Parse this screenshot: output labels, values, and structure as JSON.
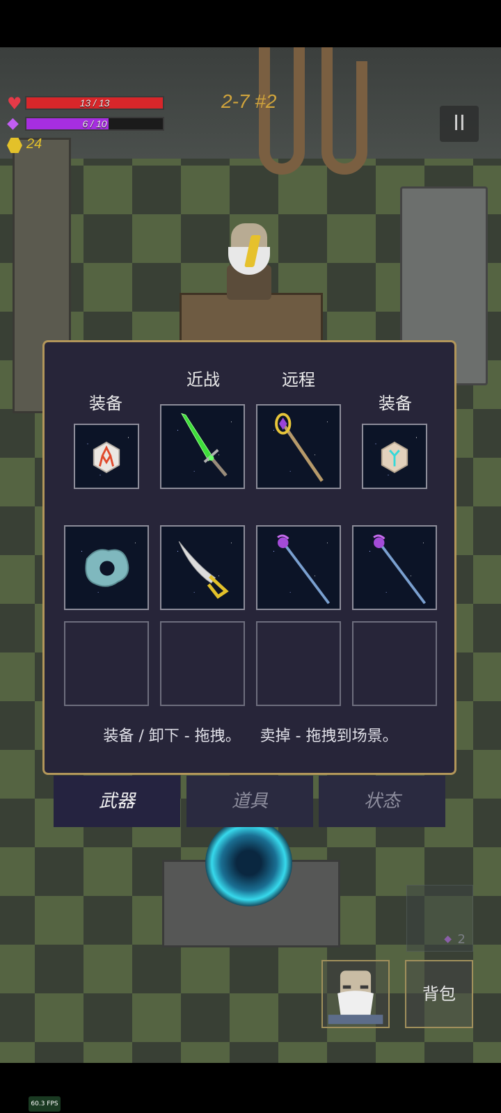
{
  "hud": {
    "hp": {
      "current": 13,
      "max": 13,
      "text": "13 / 13",
      "color": "#d8262a"
    },
    "mana": {
      "current": 6,
      "max": 10,
      "text": "6 / 10",
      "color": "#a62ee0"
    },
    "coins": "24",
    "stage": "2-7 #2"
  },
  "panel": {
    "labels": {
      "equip_left": "装备",
      "melee": "近战",
      "ranged": "远程",
      "equip_right": "装备"
    },
    "equipped": [
      {
        "name": "rune-stone-red-icon"
      },
      {
        "name": "green-sword-icon"
      },
      {
        "name": "golden-staff-icon"
      },
      {
        "name": "rune-stone-cyan-icon"
      }
    ],
    "inventory": [
      {
        "name": "blue-ring-icon"
      },
      {
        "name": "scimitar-icon"
      },
      {
        "name": "purple-staff-icon"
      },
      {
        "name": "purple-staff-icon"
      },
      {
        "name": ""
      },
      {
        "name": ""
      },
      {
        "name": ""
      },
      {
        "name": ""
      }
    ],
    "hint": "装备 / 卸下 - 拖拽。    卖掉 - 拖拽到场景。"
  },
  "tabs": [
    {
      "label": "武器",
      "active": true
    },
    {
      "label": "道具",
      "active": false
    },
    {
      "label": "状态",
      "active": false
    }
  ],
  "buttons": {
    "backpack": "背包",
    "pause": "II"
  },
  "statue_count": "2",
  "fps": "60.3 FPS",
  "colors": {
    "panel_border": "#b2965a",
    "panel_bg": "#272539",
    "gold": "#e3c12a"
  }
}
